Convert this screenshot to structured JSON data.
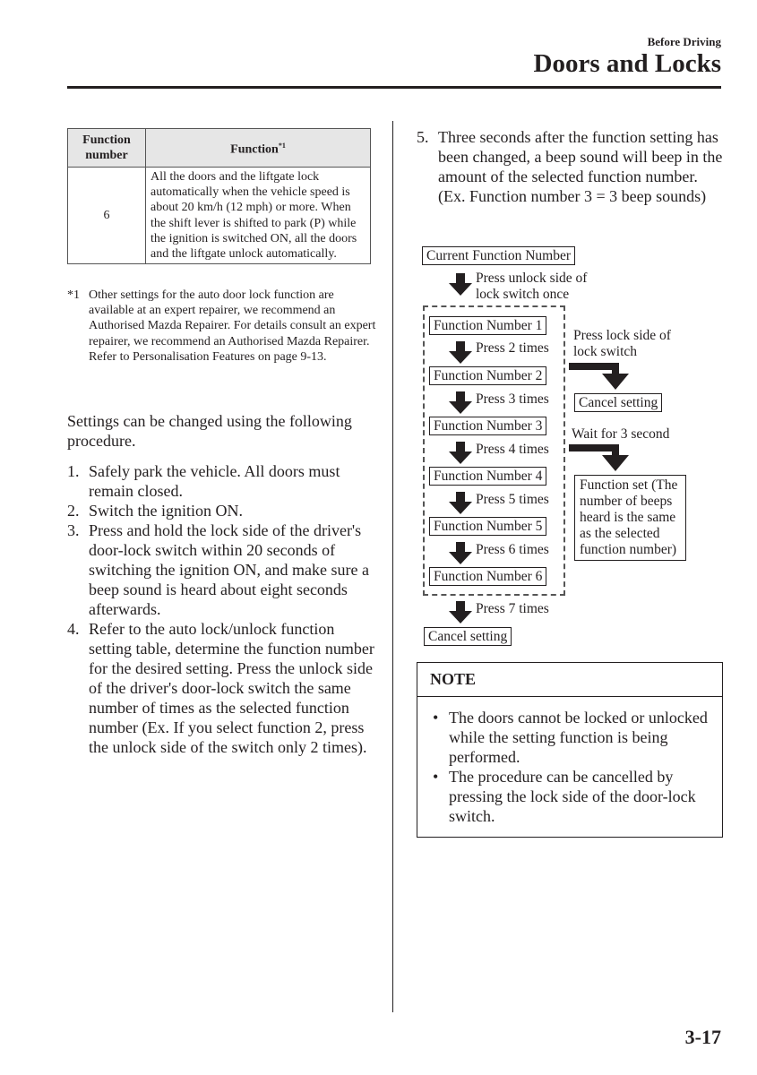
{
  "header": {
    "section": "Before Driving",
    "title": "Doors and Locks"
  },
  "table": {
    "headers": [
      "Function number",
      "Function"
    ],
    "header_footnote_mark": "*1",
    "rows": [
      {
        "number": "6",
        "function": "All the doors and the liftgate lock automatically when the vehicle speed is about 20 km/h (12 mph) or more. When the shift lever is shifted to park (P) while the ignition is switched ON, all the doors and the liftgate unlock automatically."
      }
    ]
  },
  "footnote": {
    "mark": "*1",
    "text": "Other settings for the auto door lock function are available at an expert repairer, we recommend an Authorised Mazda Repairer. For details consult an expert repairer, we recommend an Authorised Mazda Repairer. Refer to Personalisation Features on page 9-13."
  },
  "intro": "Settings can be changed using the following procedure.",
  "steps": [
    {
      "n": "1.",
      "text": "Safely park the vehicle. All doors must remain closed."
    },
    {
      "n": "2.",
      "text": "Switch the ignition ON."
    },
    {
      "n": "3.",
      "text": "Press and hold the lock side of the driver's door-lock switch within 20 seconds of switching the ignition ON, and make sure a beep sound is heard about eight seconds afterwards."
    },
    {
      "n": "4.",
      "text": "Refer to the auto lock/unlock function setting table, determine the function number for the desired setting. Press the unlock side of the driver's door-lock switch the same number of times as the selected function number (Ex. If you select function 2, press the unlock side of the switch only 2 times)."
    },
    {
      "n": "5.",
      "text": "Three seconds after the function setting has been changed, a beep sound will beep in the amount of the selected function number. (Ex. Function number 3 = 3 beep sounds)"
    }
  ],
  "flow": {
    "start": "Current Function Number",
    "start_action": [
      "Press unlock side of",
      "lock switch once"
    ],
    "functions": [
      "Function Number 1",
      "Function Number 2",
      "Function Number 3",
      "Function Number 4",
      "Function Number 5",
      "Function Number 6"
    ],
    "presses": [
      "Press 2 times",
      "Press 3 times",
      "Press 4 times",
      "Press 5 times",
      "Press 6 times",
      "Press 7 times"
    ],
    "lock_action": [
      "Press lock side of",
      "lock switch"
    ],
    "cancel": "Cancel setting",
    "wait_action": "Wait for 3 second",
    "function_set": "Function set (The number of beeps heard is the same as the selected function number)",
    "end": "Cancel setting"
  },
  "note": {
    "heading": "NOTE",
    "items": [
      "The doors cannot be locked or unlocked while the setting function is being performed.",
      "The procedure can be cancelled by pressing the lock side of the door-lock switch."
    ]
  },
  "page_number": "3-17"
}
